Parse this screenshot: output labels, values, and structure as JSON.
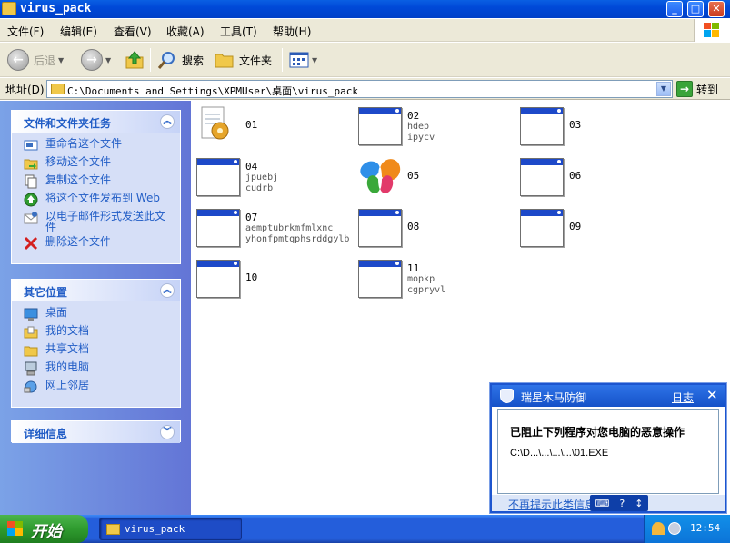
{
  "window": {
    "title": "virus_pack",
    "buttons": {
      "minimize": "_",
      "maximize": "□",
      "close": "✕"
    }
  },
  "menu": [
    "文件(F)",
    "编辑(E)",
    "查看(V)",
    "收藏(A)",
    "工具(T)",
    "帮助(H)"
  ],
  "toolbar": {
    "back": "后退",
    "search": "搜索",
    "folders": "文件夹"
  },
  "address": {
    "label": "地址(D)",
    "value": "C:\\Documents and Settings\\XPMUser\\桌面\\virus_pack",
    "go": "转到"
  },
  "tasks_panel": {
    "title": "文件和文件夹任务",
    "items": [
      {
        "label": "重命名这个文件",
        "icon": "rename-icon"
      },
      {
        "label": "移动这个文件",
        "icon": "move-icon"
      },
      {
        "label": "复制这个文件",
        "icon": "copy-icon"
      },
      {
        "label": "将这个文件发布到 Web",
        "icon": "publish-web-icon"
      },
      {
        "label": "以电子邮件形式发送此文件",
        "icon": "email-icon"
      },
      {
        "label": "删除这个文件",
        "icon": "delete-icon"
      }
    ]
  },
  "places_panel": {
    "title": "其它位置",
    "items": [
      {
        "label": "桌面",
        "icon": "desktop-icon"
      },
      {
        "label": "我的文档",
        "icon": "my-documents-icon"
      },
      {
        "label": "共享文档",
        "icon": "shared-documents-icon"
      },
      {
        "label": "我的电脑",
        "icon": "my-computer-icon"
      },
      {
        "label": "网上邻居",
        "icon": "network-icon"
      }
    ]
  },
  "details_panel": {
    "title": "详细信息"
  },
  "files": [
    {
      "name": "01",
      "sub": [],
      "icon": "setup-icon"
    },
    {
      "name": "02",
      "sub": [
        "hdep",
        "ipycv"
      ],
      "icon": "window-app-icon"
    },
    {
      "name": "03",
      "sub": [],
      "icon": "window-app-icon"
    },
    {
      "name": "04",
      "sub": [
        "jpuebj",
        "cudrb"
      ],
      "icon": "window-app-icon"
    },
    {
      "name": "05",
      "sub": [],
      "icon": "msn-butterfly-icon"
    },
    {
      "name": "06",
      "sub": [],
      "icon": "window-app-icon"
    },
    {
      "name": "07",
      "sub": [
        "aemptubrkmfmlxnc",
        "yhonfpmtqphsrddgylb"
      ],
      "icon": "window-app-icon"
    },
    {
      "name": "08",
      "sub": [],
      "icon": "window-app-icon"
    },
    {
      "name": "09",
      "sub": [],
      "icon": "window-app-icon"
    },
    {
      "name": "10",
      "sub": [],
      "icon": "window-app-icon"
    },
    {
      "name": "11",
      "sub": [
        "mopkp",
        "cgpryvl"
      ],
      "icon": "window-app-icon"
    }
  ],
  "popup": {
    "title": "瑞星木马防御",
    "log": "日志",
    "close": "✕",
    "message": "已阻止下列程序对您电脑的恶意操作",
    "file": "C:\\D...\\...\\...\\...\\01.EXE",
    "dont_show": "不再提示此类信息",
    "tools": [
      "⌨",
      "?",
      "↕"
    ]
  },
  "taskbar": {
    "start": "开始",
    "task": "virus_pack",
    "clock": "12:54"
  },
  "colors": {
    "title_bar": "#0a5fe3",
    "left_pane": "#7ba2e7",
    "panel_link": "#215dc6",
    "taskbar": "#245edb",
    "start_button": "#2f9b2f"
  }
}
